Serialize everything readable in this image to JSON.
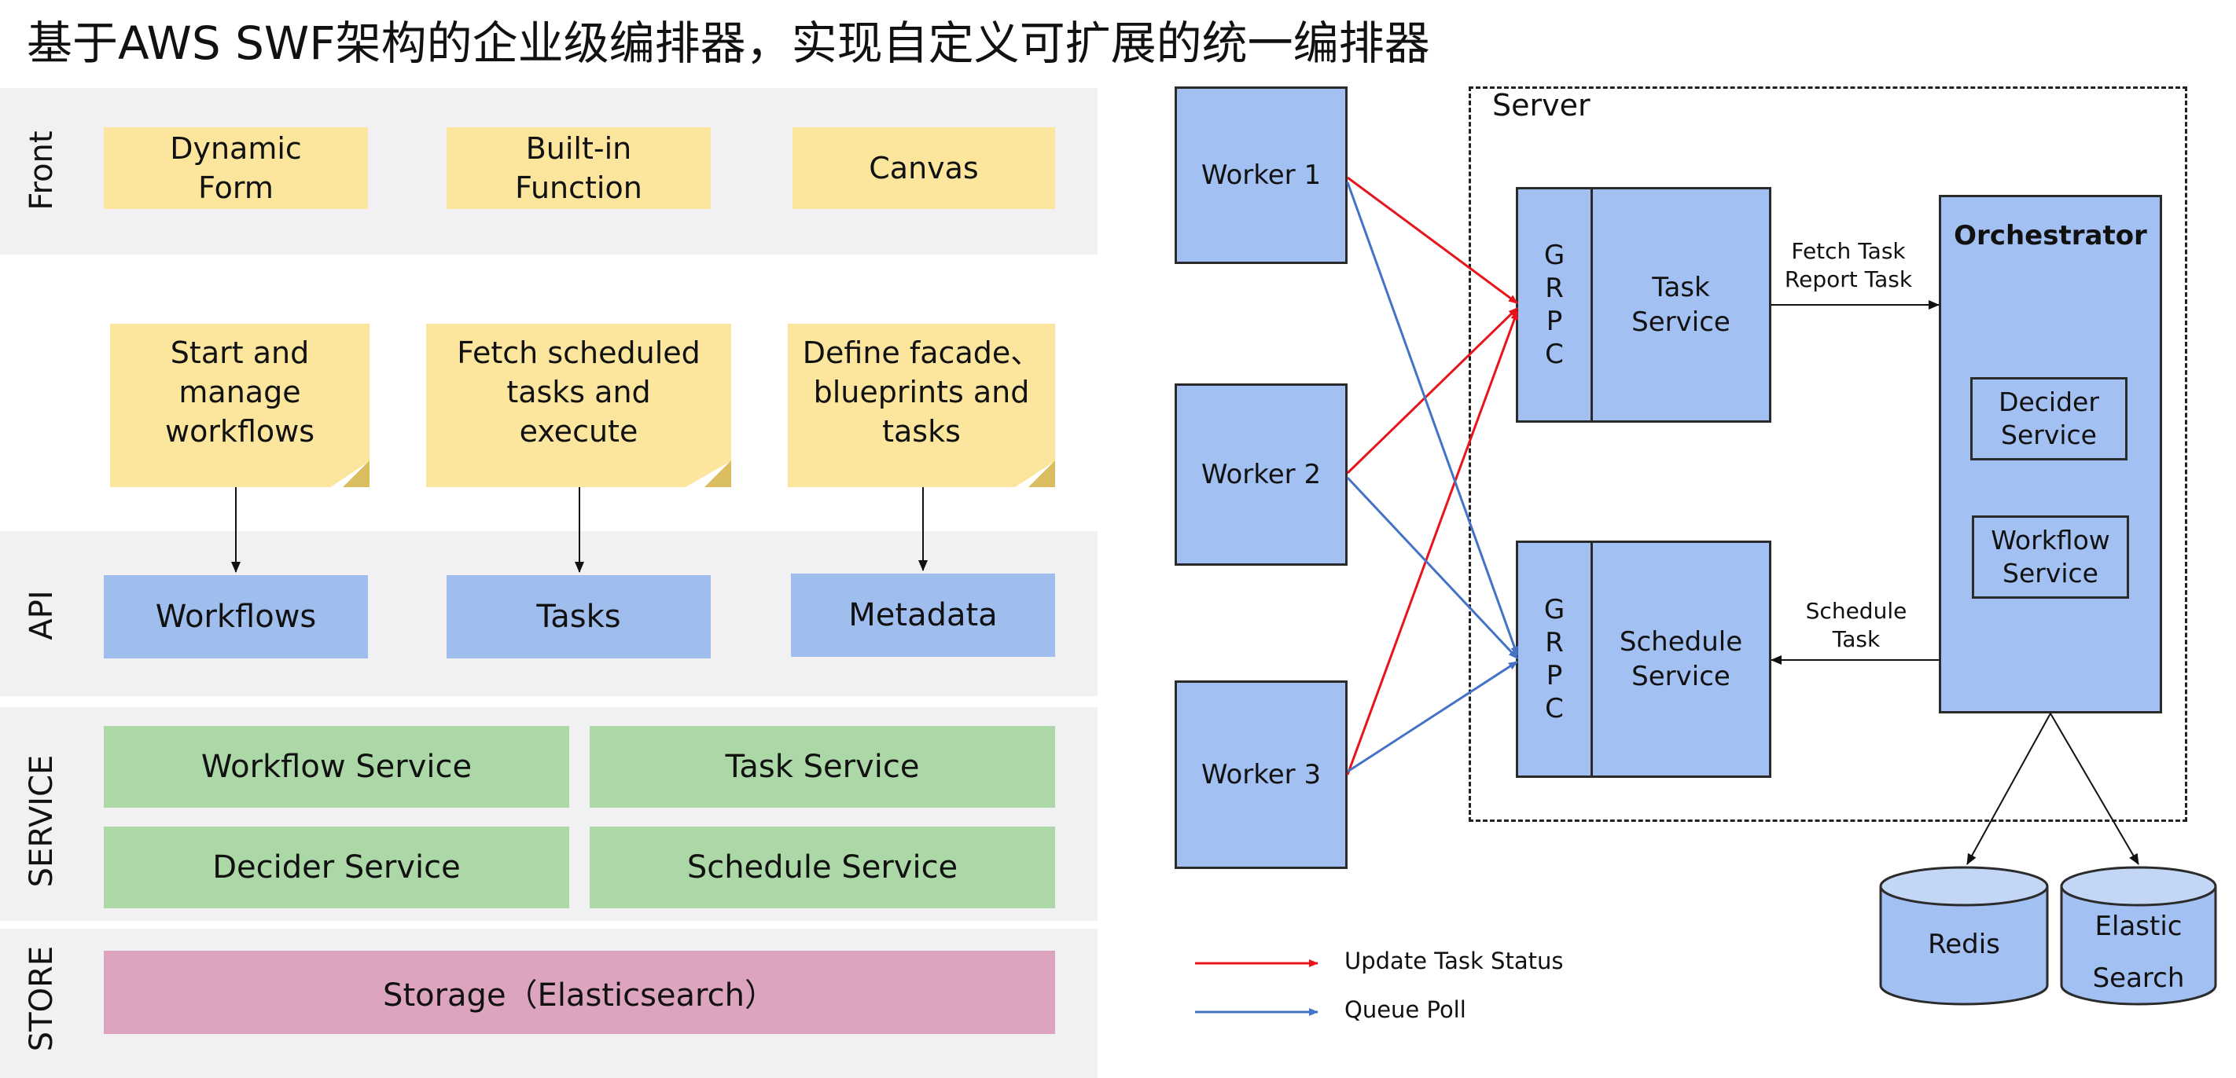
{
  "title": "基于AWS SWF架构的企业级编排器，实现自定义可扩展的统一编排器",
  "left": {
    "bands": {
      "front": "Front",
      "api": "API",
      "service": "SERVICE",
      "store": "STORE"
    },
    "front_items": [
      "Dynamic\nForm",
      "Built-in\nFunction",
      "Canvas"
    ],
    "notes": [
      "Start and\nmanage\nworkflows",
      "Fetch scheduled\ntasks and\nexecute",
      "Define facade、\nblueprints and\ntasks"
    ],
    "api_items": [
      "Workflows",
      "Tasks",
      "Metadata"
    ],
    "services": [
      "Workflow Service",
      "Task Service",
      "Decider Service",
      "Schedule Service"
    ],
    "storage": "Storage（Elasticsearch）"
  },
  "right": {
    "server_label": "Server",
    "workers": [
      "Worker 1",
      "Worker 2",
      "Worker 3"
    ],
    "grpc_letters": [
      "G",
      "R",
      "P",
      "C"
    ],
    "task_service": "Task\nService",
    "schedule_service": "Schedule\nService",
    "orchestrator": "Orchestrator",
    "decider_service": "Decider\nService",
    "workflow_service": "Workflow\nService",
    "fetch_label": "Fetch Task\nReport Task",
    "schedule_label": "Schedule\nTask",
    "redis": "Redis",
    "elastic": "Elastic\nSearch",
    "legend": [
      {
        "label": "Update Task Status",
        "color": "#e8141b"
      },
      {
        "label": "Queue Poll",
        "color": "#4472c4"
      }
    ]
  },
  "colors": {
    "yellow": "#fce69d",
    "blue": "#9fbeee",
    "green": "#acd7a6",
    "pink": "#dca4be",
    "band": "#f1f1f3",
    "red_arrow": "#e8141b",
    "blue_arrow": "#4472c4"
  }
}
